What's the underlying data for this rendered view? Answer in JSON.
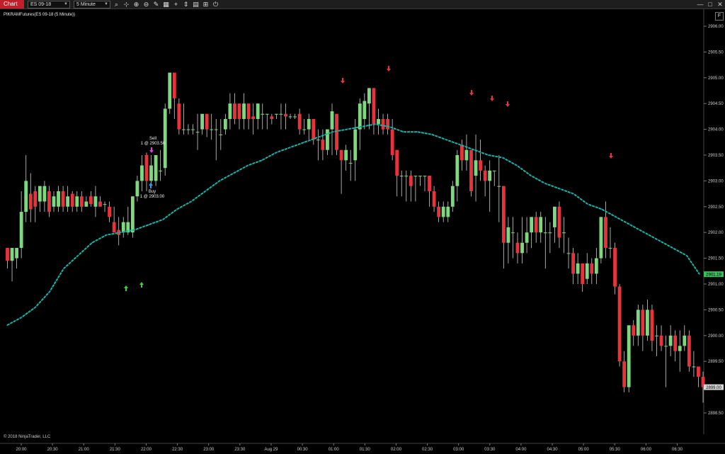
{
  "toolbar": {
    "chart_tab": "Chart",
    "instrument": "ES 09-18",
    "interval": "5 Minute",
    "tools": [
      "magnifier-icon",
      "crosshair-icon",
      "zoom-in-icon",
      "zoom-out-icon",
      "pencil-icon",
      "properties-icon",
      "plus-icon",
      "arrows-icon",
      "grid-icon",
      "trade-icon",
      "power-icon"
    ]
  },
  "window": {
    "minimize": "—",
    "maximize": "□",
    "close": "✕",
    "f_button": "F"
  },
  "chart": {
    "instrument_label": "PIKRAMFutures(ES 09-18 (5 Minute))",
    "copyright": "© 2018 NinjaTrader, LLC",
    "price_labels": [
      "2906.00",
      "2905.50",
      "2905.00",
      "2904.50",
      "2904.00",
      "2903.50",
      "2903.00",
      "2902.50",
      "2902.00",
      "2901.50",
      "2901.00",
      "2900.50",
      "2900.00",
      "2899.50",
      "2899.00",
      "2898.50"
    ],
    "time_labels": [
      "20:00",
      "20:30",
      "21:00",
      "21:30",
      "22:00",
      "22:30",
      "23:00",
      "23:30",
      "Aug 29",
      "00:30",
      "01:00",
      "01:30",
      "02:00",
      "02:30",
      "03:00",
      "03:30",
      "04:00",
      "04:30",
      "05:00",
      "05:30",
      "06:00",
      "06:30"
    ],
    "ma_value_label": "2901.19",
    "last_price_label": "2899.00",
    "sell_label": "Sell",
    "sell_detail": "1 @ 2903.50",
    "buy_label": "Buy",
    "buy_detail": "1 @ 2903.00",
    "colors": {
      "up": "#7fd87f",
      "down": "#e8333d",
      "ma": "#17b5a3",
      "ma_dot": "#2f6fd8",
      "ma_box": "#39c05a",
      "up_arrow": "#3ecf3e",
      "down_arrow": "#e8333d",
      "sell_marker": "#e040e0",
      "buy_marker": "#2a9df4",
      "background": "#000000",
      "axis_text": "#cccccc"
    }
  }
}
